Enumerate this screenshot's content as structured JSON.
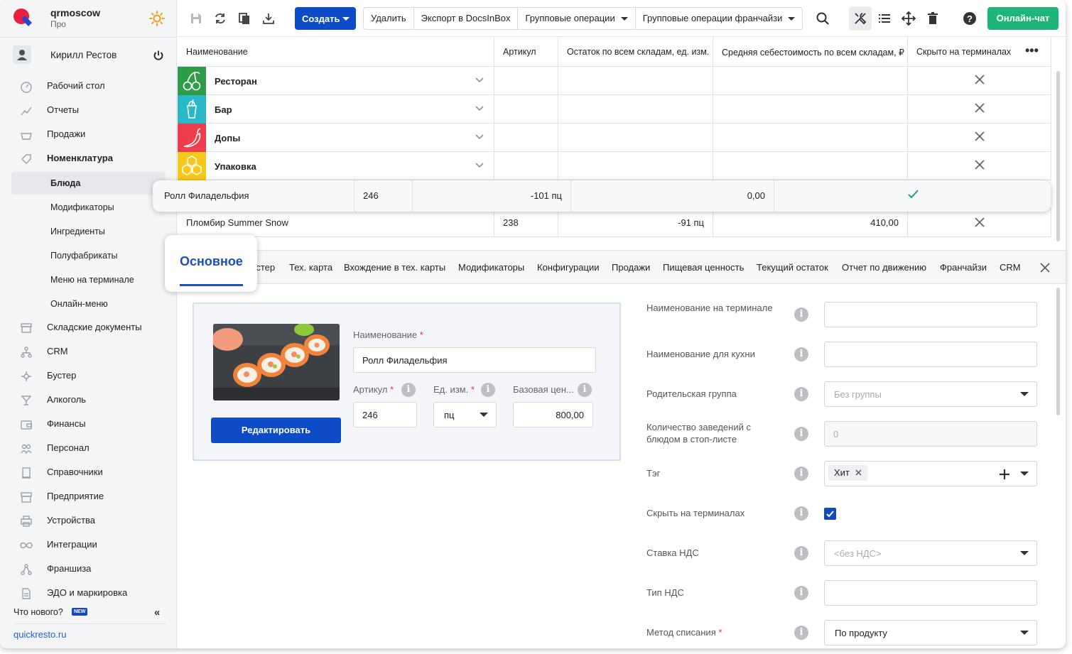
{
  "account": {
    "name": "qrmoscow",
    "plan": "Про"
  },
  "user": {
    "name": "Кирилл Рестов"
  },
  "sidebar": {
    "items": [
      {
        "label": "Рабочий стол",
        "icon": "dashboard-icon"
      },
      {
        "label": "Отчеты",
        "icon": "chart-icon"
      },
      {
        "label": "Продажи",
        "icon": "basket-icon"
      },
      {
        "label": "Номенклатура",
        "icon": "tag-icon"
      },
      {
        "label": "Складские документы",
        "icon": "archive-icon"
      },
      {
        "label": "CRM",
        "icon": "hierarchy-icon"
      },
      {
        "label": "Бустер",
        "icon": "booster-icon"
      },
      {
        "label": "Алкоголь",
        "icon": "glass-icon"
      },
      {
        "label": "Финансы",
        "icon": "wallet-icon"
      },
      {
        "label": "Персонал",
        "icon": "people-icon"
      },
      {
        "label": "Справочники",
        "icon": "book-icon"
      },
      {
        "label": "Предприятие",
        "icon": "store-icon"
      },
      {
        "label": "Устройства",
        "icon": "printer-icon"
      },
      {
        "label": "Интеграции",
        "icon": "infinity-icon"
      },
      {
        "label": "Франшиза",
        "icon": "network-icon"
      },
      {
        "label": "ЭДО и маркировка",
        "icon": "document-icon"
      }
    ],
    "subitems": [
      "Блюда",
      "Модификаторы",
      "Ингредиенты",
      "Полуфабрикаты",
      "Меню на терминале",
      "Онлайн-меню"
    ],
    "active_sub": "Блюда",
    "whats_new": "Что нового?",
    "new_badge": "NEW",
    "link": "quickresto.ru"
  },
  "toolbar": {
    "create": "Создать",
    "delete": "Удалить",
    "export": "Экспорт в DocsInBox",
    "group_ops": "Групповые операции",
    "group_ops_franchise": "Групповые операции франчайзи",
    "chat": "Онлайн-чат"
  },
  "table": {
    "headers": [
      "Наименование",
      "Артикул",
      "Остаток по всем складам, ед. изм.",
      "Средняя себестоимость по всем складам, ₽",
      "Скрыто на терминалах"
    ],
    "groups": [
      {
        "name": "Ресторан",
        "color": "#2f9c47",
        "icon": "cherries-icon"
      },
      {
        "name": "Бар",
        "color": "#29b8c8",
        "icon": "cocktail-icon"
      },
      {
        "name": "Допы",
        "color": "#ef3d4b",
        "icon": "chili-icon"
      },
      {
        "name": "Упаковка",
        "color": "#f6c81b",
        "icon": "honeycomb-icon"
      }
    ],
    "highlight_row": {
      "name": "Ролл Филадельфия",
      "article": "246",
      "stock": "-101 пц",
      "cost": "0,00"
    },
    "row": {
      "name": "Пломбир Summer Snow",
      "article": "238",
      "stock": "-91 пц",
      "cost": "410,00"
    }
  },
  "tabs": {
    "active": "Основное",
    "items": [
      "устер",
      "Тех. карта",
      "Вхождение в тех. карты",
      "Модификаторы",
      "Конфигурации",
      "Продажи",
      "Пищевая ценность",
      "Текущий остаток",
      "Отчет по движению",
      "Франчайзи",
      "CRM"
    ]
  },
  "form": {
    "name_label": "Наименование",
    "name_value": "Ролл Филадельфия",
    "article_label": "Артикул",
    "article_value": "246",
    "unit_label": "Ед. изм.",
    "unit_value": "пц",
    "price_label": "Базовая цен...",
    "price_value": "800,00",
    "edit_button": "Редактировать"
  },
  "right_form": {
    "terminal_name_label": "Наименование на терминале",
    "kitchen_name_label": "Наименование для кухни",
    "parent_group_label": "Родительская группа",
    "parent_group_value": "Без группы",
    "stoplist_label": "Количество заведений с блюдом в стоп-листе",
    "stoplist_value": "0",
    "tag_label": "Тэг",
    "tag_value": "Хит",
    "hide_label": "Скрыть на терминалах",
    "vat_rate_label": "Ставка НДС",
    "vat_rate_value": "<без НДС>",
    "vat_type_label": "Тип НДС",
    "writeoff_label": "Метод списания",
    "writeoff_value": "По продукту"
  },
  "colors": {
    "primary": "#0d4bc7",
    "chat": "#1fb57a",
    "active_tab": "#1c4fb8",
    "check": "#27a56b"
  }
}
